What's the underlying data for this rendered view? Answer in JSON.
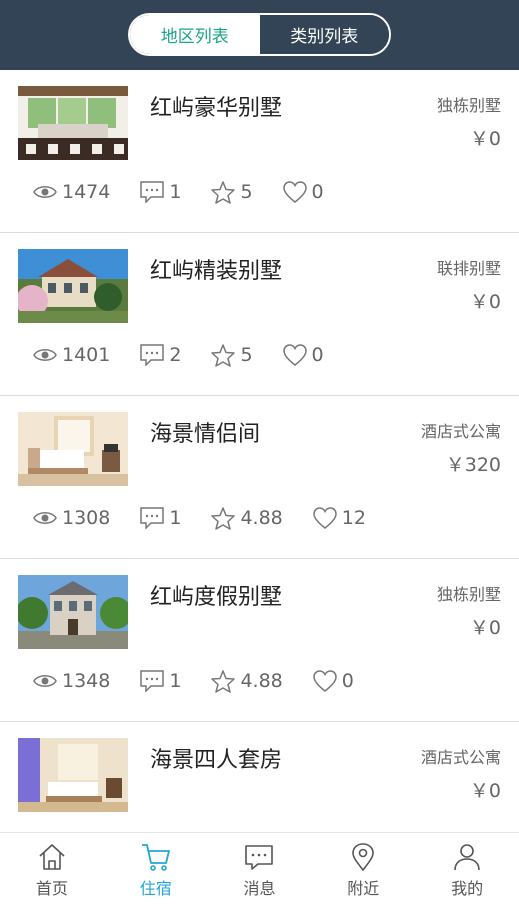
{
  "segment": {
    "tabs": [
      {
        "label": "地区列表",
        "active": true
      },
      {
        "label": "类别列表",
        "active": false
      }
    ]
  },
  "colors": {
    "header": "#324456",
    "active_tab_text": "#1aa68a",
    "tabbar_active": "#23a6d5",
    "text_gray": "#666666"
  },
  "listings": [
    {
      "name": "红屿豪华别墅",
      "category": "独栋别墅",
      "price": "￥0",
      "views": "1474",
      "comments": "1",
      "rating": "5",
      "likes": "0"
    },
    {
      "name": "红屿精装别墅",
      "category": "联排别墅",
      "price": "￥0",
      "views": "1401",
      "comments": "2",
      "rating": "5",
      "likes": "0"
    },
    {
      "name": "海景情侣间",
      "category": "酒店式公寓",
      "price": "￥320",
      "views": "1308",
      "comments": "1",
      "rating": "4.88",
      "likes": "12"
    },
    {
      "name": "红屿度假别墅",
      "category": "独栋别墅",
      "price": "￥0",
      "views": "1348",
      "comments": "1",
      "rating": "4.88",
      "likes": "0"
    },
    {
      "name": "海景四人套房",
      "category": "酒店式公寓",
      "price": "￥0"
    }
  ],
  "tabbar": [
    {
      "label": "首页",
      "icon": "home-icon",
      "active": false
    },
    {
      "label": "住宿",
      "icon": "cart-icon",
      "active": true
    },
    {
      "label": "消息",
      "icon": "message-icon",
      "active": false
    },
    {
      "label": "附近",
      "icon": "location-icon",
      "active": false
    },
    {
      "label": "我的",
      "icon": "user-icon",
      "active": false
    }
  ]
}
